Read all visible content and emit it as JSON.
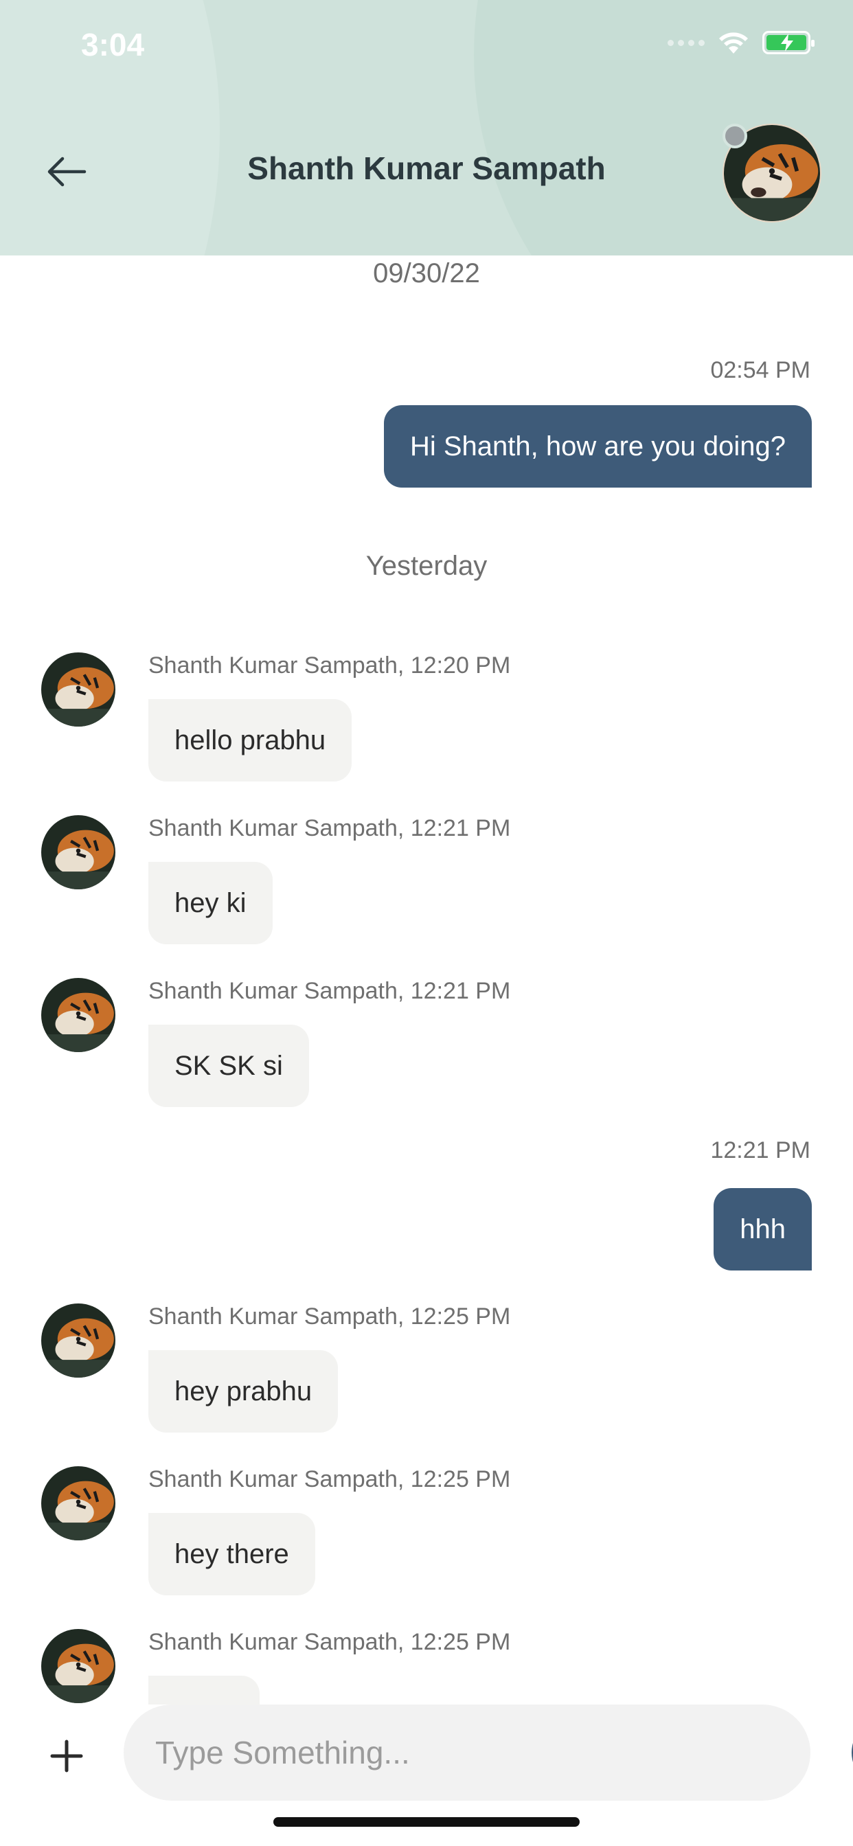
{
  "status_bar": {
    "time": "3:04"
  },
  "header": {
    "title": "Shanth Kumar Sampath"
  },
  "chat": {
    "date_1": "09/30/22",
    "out_1": {
      "time": "02:54 PM",
      "text": "Hi Shanth, how are you doing?"
    },
    "date_2": "Yesterday",
    "in_1": {
      "sender": "Shanth Kumar Sampath, 12:20 PM",
      "text": "hello prabhu"
    },
    "in_2": {
      "sender": "Shanth Kumar Sampath, 12:21 PM",
      "text": "hey ki"
    },
    "in_3": {
      "sender": "Shanth Kumar Sampath, 12:21 PM",
      "text": "SK SK si"
    },
    "out_2": {
      "time": "12:21 PM",
      "text": "hhh"
    },
    "in_4": {
      "sender": "Shanth Kumar Sampath, 12:25 PM",
      "text": "hey prabhu"
    },
    "in_5": {
      "sender": "Shanth Kumar Sampath, 12:25 PM",
      "text": "hey there"
    },
    "in_6": {
      "sender": "Shanth Kumar Sampath, 12:25 PM",
      "text": ""
    }
  },
  "composer": {
    "placeholder": "Type Something..."
  },
  "colors": {
    "header_bg": "#cfe2db",
    "outgoing_bubble": "#3e5b79",
    "incoming_bubble": "#f3f3f1",
    "battery": "#35c759"
  }
}
